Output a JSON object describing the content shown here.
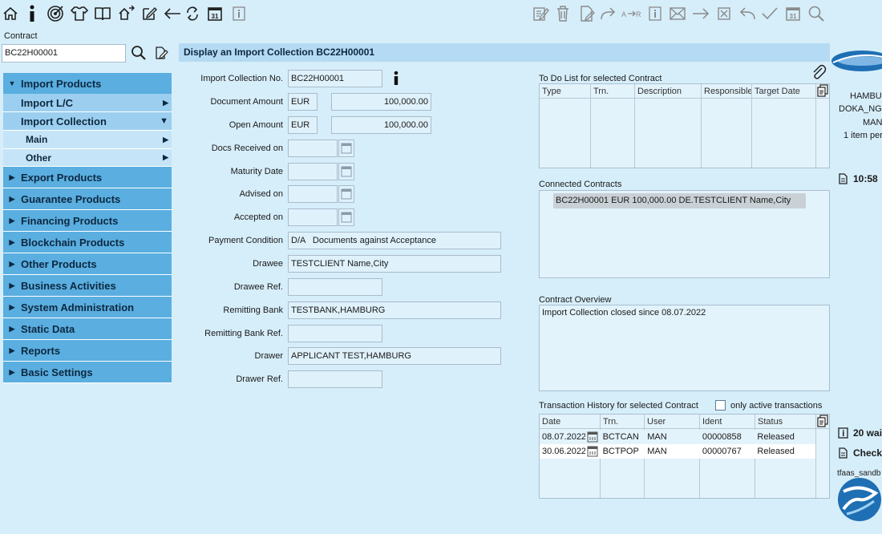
{
  "toolbar": {
    "left_icons": [
      "home-icon",
      "info-icon",
      "target-icon",
      "shirt-icon",
      "book-icon",
      "home-swap-icon",
      "edit-icon",
      "arrow-left-icon",
      "refresh-icon",
      "calendar-icon",
      "info-box-icon"
    ],
    "right_icons": [
      "edit-list-icon",
      "trash-icon",
      "file-sign-icon",
      "forward-icon",
      "swap-icon",
      "info-box-icon",
      "mail-icon",
      "arrow-right-icon",
      "close-box-icon",
      "undo-icon",
      "check-icon",
      "calendar-icon",
      "search-icon"
    ],
    "calendar_day": "31"
  },
  "contract_search": {
    "label": "Contract",
    "value": "BC22H00001"
  },
  "sidebar": {
    "items": [
      {
        "label": "Import Products",
        "level": 1,
        "expanded": true
      },
      {
        "label": "Import L/C",
        "level": 2
      },
      {
        "label": "Import Collection",
        "level": 2,
        "expanded": true
      },
      {
        "label": "Main",
        "level": 3
      },
      {
        "label": "Other",
        "level": 3
      },
      {
        "label": "Export Products",
        "level": 1
      },
      {
        "label": "Guarantee Products",
        "level": 1
      },
      {
        "label": "Financing Products",
        "level": 1
      },
      {
        "label": "Blockchain Products",
        "level": 1
      },
      {
        "label": "Other Products",
        "level": 1
      },
      {
        "label": "Business Activities",
        "level": 1
      },
      {
        "label": "System Administration",
        "level": 1
      },
      {
        "label": "Static Data",
        "level": 1
      },
      {
        "label": "Reports",
        "level": 1
      },
      {
        "label": "Basic Settings",
        "level": 1
      }
    ]
  },
  "header": {
    "title": "Display an Import Collection BC22H00001"
  },
  "form": {
    "import_collection_no": {
      "label": "Import Collection No.",
      "value": "BC22H00001"
    },
    "document_amount": {
      "label": "Document Amount",
      "currency": "EUR",
      "value": "100,000.00"
    },
    "open_amount": {
      "label": "Open Amount",
      "currency": "EUR",
      "value": "100,000.00"
    },
    "docs_received_on": {
      "label": "Docs Received on",
      "value": ""
    },
    "maturity_date": {
      "label": "Maturity Date",
      "value": ""
    },
    "advised_on": {
      "label": "Advised on",
      "value": ""
    },
    "accepted_on": {
      "label": "Accepted on",
      "value": ""
    },
    "payment_condition": {
      "label": "Payment Condition",
      "value": "D/A   Documents against Acceptance"
    },
    "drawee": {
      "label": "Drawee",
      "value": "TESTCLIENT Name,City"
    },
    "drawee_ref": {
      "label": "Drawee Ref.",
      "value": ""
    },
    "remitting_bank": {
      "label": "Remitting Bank",
      "value": "TESTBANK,HAMBURG"
    },
    "remitting_bank_ref": {
      "label": "Remitting Bank Ref.",
      "value": ""
    },
    "drawer": {
      "label": "Drawer",
      "value": "APPLICANT TEST,HAMBURG"
    },
    "drawer_ref": {
      "label": "Drawer Ref.",
      "value": ""
    }
  },
  "todo": {
    "title": "To Do List for selected Contract",
    "columns": [
      "Type",
      "Trn.",
      "Description",
      "Responsible",
      "Target Date"
    ]
  },
  "connected": {
    "title": "Connected Contracts",
    "item": "BC22H00001 EUR 100,000.00 DE.TESTCLIENT Name,City"
  },
  "overview": {
    "title": "Contract Overview",
    "text": "Import Collection closed since 08.07.2022"
  },
  "history": {
    "title": "Transaction History for selected Contract",
    "checkbox_label": "only active transactions",
    "columns": [
      "Date",
      "Trn.",
      "User",
      "Ident",
      "Status"
    ],
    "rows": [
      {
        "date": "08.07.2022",
        "trn": "BCTCAN",
        "user": "MAN",
        "ident": "00000858",
        "status": "Released"
      },
      {
        "date": "30.06.2022",
        "trn": "BCTPOP",
        "user": "MAN",
        "ident": "00000767",
        "status": "Released"
      }
    ]
  },
  "right_panel": {
    "line1": "HAMBU",
    "line2": "DOKA_NG",
    "line3": "MAN",
    "line4": "1 item per",
    "time": "10:58",
    "waiting": "20 wai",
    "check": "Check",
    "sandbox": "tfaas_sandb"
  },
  "colors": {
    "background": "#d6eefa",
    "sidebar_l1": "#5aaee0",
    "sidebar_l2": "#9ccfef",
    "header": "#b5daf3",
    "selected_row": "#c9d1d6"
  }
}
